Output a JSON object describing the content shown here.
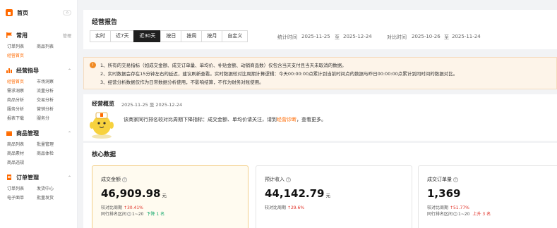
{
  "sidebar": {
    "home_label": "首页",
    "home_badge": "pin",
    "groups": [
      {
        "title": "常用",
        "extra": "管理",
        "items": [
          {
            "label": "订单列表"
          },
          {
            "label": "商品列表"
          },
          {
            "label": "经营首页"
          }
        ]
      },
      {
        "title": "经营指导",
        "items": [
          {
            "label": "经营首页"
          },
          {
            "label": "市场洞察"
          },
          {
            "label": "需求洞察"
          },
          {
            "label": "流量分析"
          },
          {
            "label": "商品分析"
          },
          {
            "label": "交易分析"
          },
          {
            "label": "服务分析"
          },
          {
            "label": "营销分析"
          },
          {
            "label": "报表下载"
          },
          {
            "label": "服务分"
          }
        ]
      },
      {
        "title": "商品管理",
        "items": [
          {
            "label": "商品列表"
          },
          {
            "label": "批量管理"
          },
          {
            "label": "商品素材"
          },
          {
            "label": "商品体检"
          },
          {
            "label": "商品违规"
          }
        ]
      },
      {
        "title": "订单管理",
        "items": [
          {
            "label": "订单列表"
          },
          {
            "label": "发货中心"
          },
          {
            "label": "电子面单"
          },
          {
            "label": "批量发货"
          }
        ]
      }
    ]
  },
  "report": {
    "title": "经营报告",
    "tabs": [
      "实时",
      "近7天",
      "近30天",
      "按日",
      "按周",
      "按月",
      "自定义"
    ],
    "selected_tab": "近30天",
    "stat_label": "统计时间",
    "stat_start": "2025-11-25",
    "stat_to": "至",
    "stat_end": "2025-12-24",
    "cmp_label": "对比时间",
    "cmp_start": "2025-10-26",
    "cmp_to": "至",
    "cmp_end": "2025-11-24"
  },
  "notice": {
    "lines": [
      "1、所有的交易指标（如成交金额、成交订单量、单均价、补贴金额、动销商品数）仅包含当天支付且当天未取消的数据。",
      "2、实时数据会存在15分钟左右的延迟，建议刷新查看。实时数据较对比周期计算逻辑：今天00:00:00点累计到当前时间点的数据与昨日00:00:00点累计到同时间的数据对比。",
      "3、经营分析数据仅作为日常数据分析使用，不影响结算，不作为财务对账使用。"
    ]
  },
  "overview": {
    "title": "经营概览",
    "date_range": "2025-11-25 至 2025-12-24",
    "text_before": "该商家同行排名较对比周期下降指标：成交金额、单均价请关注，请到",
    "link": "经营诊断",
    "text_after": "，查看更多。"
  },
  "core": {
    "title": "核心数据",
    "metrics": [
      {
        "label": "成交金额",
        "value": "46,909.98",
        "unit": "元",
        "cmp_label": "较对比周期",
        "change": "30.41%",
        "rank_label": "同行排名区间",
        "rank": "1~20",
        "rank_change": "下降 1 名",
        "rank_dir": "down"
      },
      {
        "label": "预计收入",
        "value": "44,142.79",
        "unit": "元",
        "cmp_label": "较对比周期",
        "change": "29.6%",
        "rank_label": "",
        "rank": "",
        "rank_change": "",
        "rank_dir": ""
      },
      {
        "label": "成交订单量",
        "value": "1,369",
        "unit": "",
        "cmp_label": "较对比周期",
        "change": "51.77%",
        "rank_label": "同行排名区间",
        "rank": "1~20",
        "rank_change": "上升 3 名",
        "rank_dir": "up"
      }
    ]
  },
  "colors": {
    "accent": "#ff6a00",
    "up": "#e02e24",
    "down": "#13a86b",
    "notice_bg": "#fdf4e9"
  }
}
